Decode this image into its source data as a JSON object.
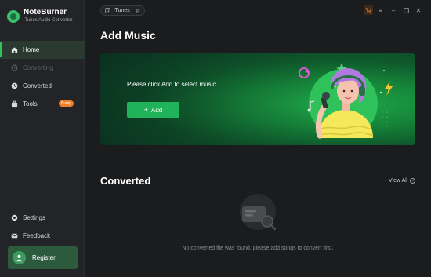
{
  "app": {
    "name": "NoteBurner",
    "subtitle": "iTunes Audio Converter"
  },
  "sidebar": {
    "items": [
      {
        "label": "Home",
        "icon": "home-icon",
        "state": "active"
      },
      {
        "label": "Converting",
        "icon": "converting-icon",
        "state": "disabled"
      },
      {
        "label": "Converted",
        "icon": "clock-icon",
        "state": "normal"
      },
      {
        "label": "Tools",
        "icon": "toolbox-icon",
        "state": "normal",
        "badge": "Bump"
      }
    ],
    "bottom_items": [
      {
        "label": "Settings",
        "icon": "gear-icon"
      },
      {
        "label": "Feedback",
        "icon": "mail-icon"
      }
    ],
    "register_label": "Register"
  },
  "topbar": {
    "source_label": "iTunes",
    "source_icon": "music-note-icon",
    "controls": [
      "cart-icon",
      "menu-icon",
      "minimize-icon",
      "maximize-icon",
      "close-icon"
    ]
  },
  "main": {
    "add_music_title": "Add Music",
    "banner_text": "Please click Add to select music",
    "add_button_label": "Add",
    "converted_title": "Converted",
    "view_all_label": "View All",
    "empty_text": "No converted file was found, please add songs to convert first."
  },
  "colors": {
    "accent": "#21b359",
    "badge": "#f07f2a",
    "background": "#1b1c1e",
    "sidebar": "#232427"
  }
}
